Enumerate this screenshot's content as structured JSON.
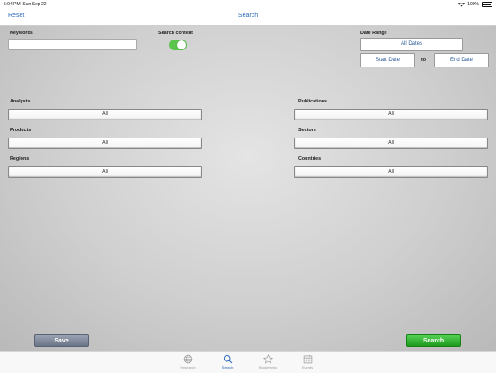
{
  "status": {
    "time": "5:04 PM",
    "date": "Sun Sep 22",
    "battery": "100%"
  },
  "nav": {
    "left_label": "Reset",
    "title": "Search"
  },
  "form": {
    "keywords_label": "Keywords",
    "keywords_value": "",
    "search_content_label": "Search content",
    "search_content_on": true,
    "date_range_label": "Date Range",
    "all_dates_label": "All Dates",
    "start_date_label": "Start Date",
    "to_label": "to",
    "end_date_label": "End Date",
    "analysts_label": "Analysts",
    "analysts_value": "All",
    "publications_label": "Publications",
    "publications_value": "All",
    "products_label": "Products",
    "products_value": "All",
    "sectors_label": "Sectors",
    "sectors_value": "All",
    "regions_label": "Regions",
    "regions_value": "All",
    "countries_label": "Countries",
    "countries_value": "All"
  },
  "actions": {
    "save_label": "Save",
    "search_label": "Search"
  },
  "tabs": [
    {
      "label": "Research",
      "icon": "globe-icon",
      "active": false
    },
    {
      "label": "Search",
      "icon": "search-icon",
      "active": true
    },
    {
      "label": "Bookmarks",
      "icon": "star-icon",
      "active": false
    },
    {
      "label": "Events",
      "icon": "calendar-icon",
      "active": false
    }
  ],
  "colors": {
    "accent": "#2a68b8",
    "toggle_on": "#5ac44b",
    "search_button": "#2aa52a",
    "save_button": "#7d8698"
  }
}
